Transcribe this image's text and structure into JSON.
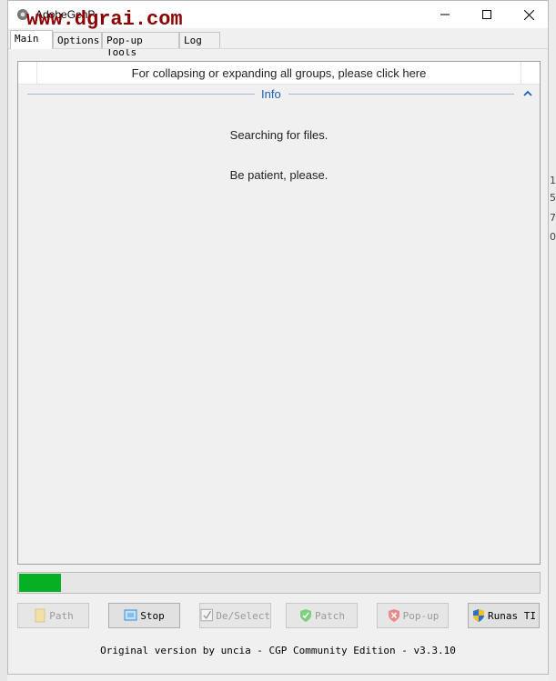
{
  "window": {
    "title": "AdobeGenP",
    "watermark": "www.dgrai.com",
    "controls": {
      "minimize": "minimize",
      "maximize": "maximize",
      "close": "close"
    }
  },
  "tabs": [
    {
      "label": "Main",
      "active": true
    },
    {
      "label": "Options",
      "active": false
    },
    {
      "label": "Pop-up Tools",
      "active": false
    },
    {
      "label": "Log",
      "active": false
    }
  ],
  "main": {
    "collapse_hint": "For collapsing or expanding all groups, please click here",
    "group_title": "Info",
    "messages": [
      "Searching for files.",
      "Be patient, please."
    ]
  },
  "progress": {
    "percent": 8,
    "color": "#06b025"
  },
  "buttons": [
    {
      "label": "Path",
      "icon": "folder-icon",
      "enabled": false
    },
    {
      "label": "Stop",
      "icon": "stop-icon",
      "enabled": true
    },
    {
      "label": "De/Select",
      "icon": "checkbox-icon",
      "enabled": false
    },
    {
      "label": "Patch",
      "icon": "shield-check-icon",
      "enabled": false
    },
    {
      "label": "Pop-up",
      "icon": "shield-x-icon",
      "enabled": false
    },
    {
      "label": "Runas TI",
      "icon": "uac-shield-icon",
      "enabled": true
    }
  ],
  "footer": "Original version by uncia - CGP Community Edition - v3.3.10",
  "background_chars": [
    "1",
    "5",
    "7",
    "0"
  ]
}
